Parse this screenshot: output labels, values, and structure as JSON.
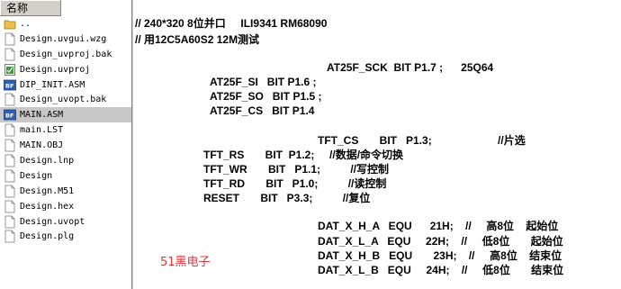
{
  "file_pane": {
    "header": "名称",
    "files": [
      {
        "name": "..",
        "icon": "folder-icon"
      },
      {
        "name": "Design.uvgui.wzg",
        "icon": "file-icon"
      },
      {
        "name": "Design_uvproj.bak",
        "icon": "file-icon"
      },
      {
        "name": "Design.uvproj",
        "icon": "uvproj-icon"
      },
      {
        "name": "DIP_INIT.ASM",
        "icon": "asm-icon"
      },
      {
        "name": "Design_uvopt.bak",
        "icon": "file-icon"
      },
      {
        "name": "MAIN.ASM",
        "icon": "asm-icon",
        "selected": true
      },
      {
        "name": "main.LST",
        "icon": "file-icon"
      },
      {
        "name": "MAIN.OBJ",
        "icon": "file-icon"
      },
      {
        "name": "Design.lnp",
        "icon": "file-icon"
      },
      {
        "name": "Design",
        "icon": "file-icon"
      },
      {
        "name": "Design.M51",
        "icon": "file-icon"
      },
      {
        "name": "Design.hex",
        "icon": "file-icon"
      },
      {
        "name": "Design.uvopt",
        "icon": "file-icon"
      },
      {
        "name": "Design.plg",
        "icon": "file-icon"
      }
    ]
  },
  "code": {
    "line1": "// 240*320 8位并口     ILI9341 RM68090",
    "line2": "// 用12C5A60S2 12M测试",
    "line3": "AT25F_SCK  BIT P1.7 ;      25Q64",
    "line4": "AT25F_SI   BIT P1.6 ;",
    "line5": "AT25F_SO   BIT P1.5 ;",
    "line6": "AT25F_CS   BIT P1.4",
    "line7": "TFT_CS       BIT   P1.3;                      //片选",
    "line8": "TFT_RS       BIT  P1.2;     //数据/命令切换",
    "line9": "TFT_WR       BIT   P1.1;          //写控制",
    "line10": "TFT_RD       BIT   P1.0;          //读控制",
    "line11": "RESET       BIT   P3.3;          //复位",
    "line12": "DAT_X_H_A   EQU      21H;    //     高8位    起始位",
    "line13": "DAT_X_L_A   EQU     22H;    //     低8位       起始位",
    "line14": "DAT_X_H_B   EQU       23H;    //     高8位    结束位",
    "line15": "DAT_X_L_B   EQU     24H;    //     低8位       结束位"
  },
  "watermark": "51黑电子",
  "colors": {
    "watermark": "#e0363a",
    "selection": "#c8c8c8",
    "pane_bg": "#ffffff",
    "chrome": "#d4d0c8"
  }
}
